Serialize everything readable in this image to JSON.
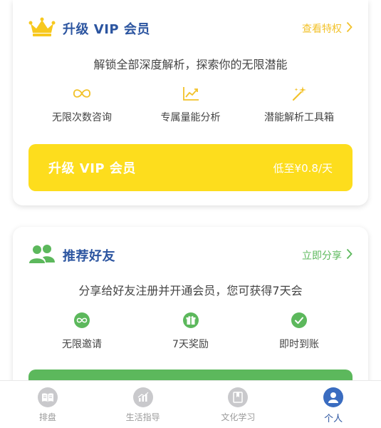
{
  "colors": {
    "brand_blue": "#2c55a0",
    "vip_yellow": "#fddd1d",
    "link_yellow": "#f2c22b",
    "share_green": "#5cb85c"
  },
  "vip_card": {
    "title": "升级 VIP 会员",
    "icon": "crown-icon",
    "link_label": "查看特权",
    "subtitle": "解锁全部深度解析，探索你的无限潜能",
    "features": [
      {
        "label": "无限次数咨询",
        "icon": "infinity-icon"
      },
      {
        "label": "专属量能分析",
        "icon": "trend-chart-icon"
      },
      {
        "label": "潜能解析工具箱",
        "icon": "magic-wand-icon"
      }
    ],
    "cta_label": "升级 VIP 会员",
    "cta_price": "低至¥0.8/天"
  },
  "friend_card": {
    "title": "推荐好友",
    "icon": "users-icon",
    "link_label": "立即分享",
    "subtitle": "分享给好友注册并开通会员，您可获得7天会",
    "features": [
      {
        "label": "无限邀请",
        "icon": "infinity-circle-icon"
      },
      {
        "label": "7天奖励",
        "icon": "gift-icon"
      },
      {
        "label": "即时到账",
        "icon": "check-circle-icon"
      }
    ]
  },
  "tabbar": {
    "tabs": [
      {
        "label": "排盘",
        "icon": "book-icon",
        "active": false
      },
      {
        "label": "生活指导",
        "icon": "chart-icon",
        "active": false
      },
      {
        "label": "文化学习",
        "icon": "bookmark-icon",
        "active": false
      },
      {
        "label": "个人",
        "icon": "person-icon",
        "active": true
      }
    ]
  }
}
